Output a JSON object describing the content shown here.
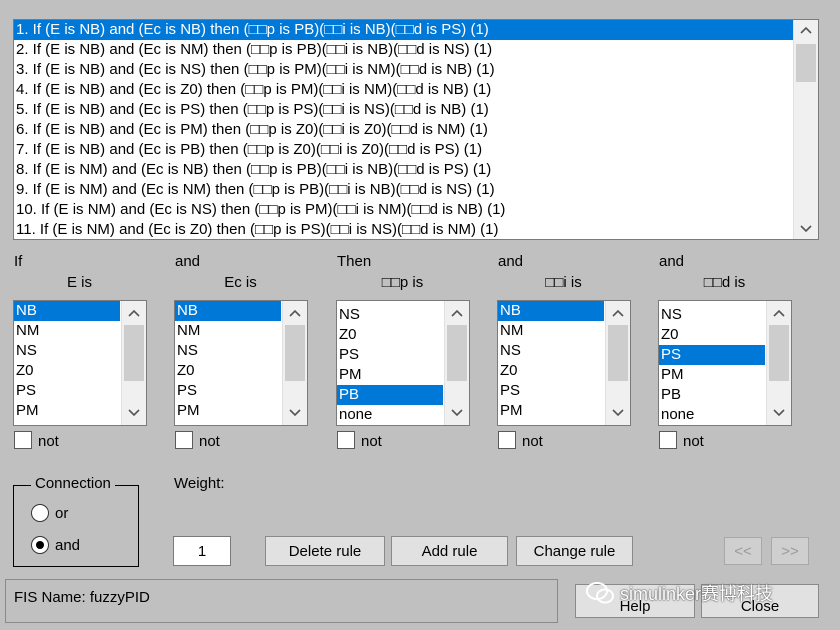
{
  "rules": [
    "1. If (E is NB) and (Ec is NB) then (□□p is PB)(□□i is NB)(□□d is PS) (1)",
    "2. If (E is NB) and (Ec is NM) then (□□p is PB)(□□i is NB)(□□d is NS) (1)",
    "3. If (E is NB) and (Ec is NS) then (□□p is PM)(□□i is NM)(□□d is NB) (1)",
    "4. If (E is NB) and (Ec is Z0) then (□□p is PM)(□□i is NM)(□□d is NB) (1)",
    "5. If (E is NB) and (Ec is PS) then (□□p is PS)(□□i is NS)(□□d is NB) (1)",
    "6. If (E is NB) and (Ec is PM) then (□□p is Z0)(□□i is Z0)(□□d is NM) (1)",
    "7. If (E is NB) and (Ec is PB) then (□□p is Z0)(□□i is Z0)(□□d is PS) (1)",
    "8. If (E is NM) and (Ec is NB) then (□□p is PB)(□□i is NB)(□□d is PS) (1)",
    "9. If (E is NM) and (Ec is NM) then (□□p is PB)(□□i is NB)(□□d is NS) (1)",
    "10. If (E is NM) and (Ec is NS) then (□□p is PM)(□□i is NM)(□□d is NB) (1)",
    "11. If (E is NM) and (Ec is Z0) then (□□p is PS)(□□i is NS)(□□d is NM) (1)"
  ],
  "selected_rule": 0,
  "columns": [
    {
      "connector": "If",
      "label": "E is",
      "items": [
        "NB",
        "NM",
        "NS",
        "Z0",
        "PS",
        "PM"
      ],
      "selected": 0,
      "not_label": "not"
    },
    {
      "connector": "and",
      "label": "Ec is",
      "items": [
        "NB",
        "NM",
        "NS",
        "Z0",
        "PS",
        "PM"
      ],
      "selected": 0,
      "not_label": "not"
    },
    {
      "connector": "Then",
      "label": "□□p is",
      "items": [
        "NS",
        "Z0",
        "PS",
        "PM",
        "PB",
        "none"
      ],
      "selected": 4,
      "not_label": "not"
    },
    {
      "connector": "and",
      "label": "□□i is",
      "items": [
        "NB",
        "NM",
        "NS",
        "Z0",
        "PS",
        "PM"
      ],
      "selected": 0,
      "not_label": "not"
    },
    {
      "connector": "and",
      "label": "□□d is",
      "items": [
        "NS",
        "Z0",
        "PS",
        "PM",
        "PB",
        "none"
      ],
      "selected": 2,
      "not_label": "not"
    }
  ],
  "connection": {
    "title": "Connection",
    "or_label": "or",
    "and_label": "and",
    "selected": "and"
  },
  "weight": {
    "label": "Weight:",
    "value": "1"
  },
  "buttons": {
    "delete": "Delete rule",
    "add": "Add rule",
    "change": "Change rule",
    "prev": "<<",
    "next": ">>",
    "help": "Help",
    "close": "Close"
  },
  "status": "FIS Name: fuzzyPID",
  "watermark": "simulinker赛博科技",
  "colors": {
    "selection": "#0078d7",
    "window": "#c0c0c0"
  }
}
